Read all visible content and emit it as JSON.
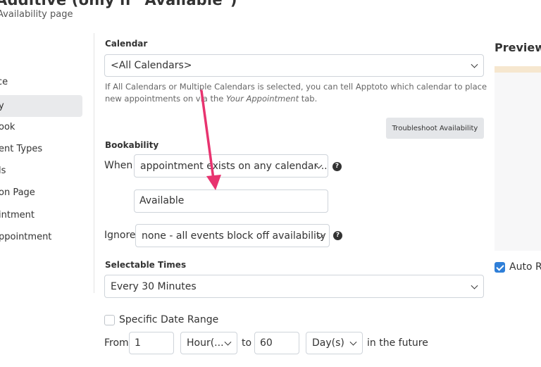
{
  "header": {
    "title": "Additive (only if \"Available\")",
    "subtitle": "Availability page"
  },
  "sidebar": {
    "items": [
      {
        "label": "ce"
      },
      {
        "label": "y"
      },
      {
        "label": "ook"
      },
      {
        "label": "ent Types"
      },
      {
        "label": "ls"
      },
      {
        "label": "on Page"
      },
      {
        "label": "intment"
      },
      {
        "label": "ppointment"
      }
    ]
  },
  "calendar": {
    "label": "Calendar",
    "selected": "<All Calendars>",
    "help_before": "If All Calendars or Multiple Calendars is selected, you can tell Apptoto which calendar to place new appointments on via the ",
    "help_link": "Your Appointment",
    "help_after": " tab."
  },
  "troubleshoot": {
    "label": "Troubleshoot Availability"
  },
  "bookability": {
    "label": "Bookability",
    "when_label": "When",
    "when_value": "appointment exists on any calendar ...",
    "match_value": "Available",
    "ignore_label": "Ignore",
    "ignore_value": "none - all events block off availability"
  },
  "selectable_times": {
    "label": "Selectable Times",
    "value": "Every 30 Minutes"
  },
  "date_range": {
    "checkbox_label": "Specific Date Range",
    "from_label": "From",
    "from_value": "1",
    "from_unit": "Hour(...",
    "to_label": "to",
    "to_value": "60",
    "to_unit": "Day(s)",
    "suffix": "in the future"
  },
  "preview": {
    "title": "Preview",
    "auto_refresh_label": "Auto Re"
  },
  "colors": {
    "arrow": "#e8336f",
    "checkbox_accent": "#2f7fd8",
    "preview_strip": "#f6e7cf"
  }
}
